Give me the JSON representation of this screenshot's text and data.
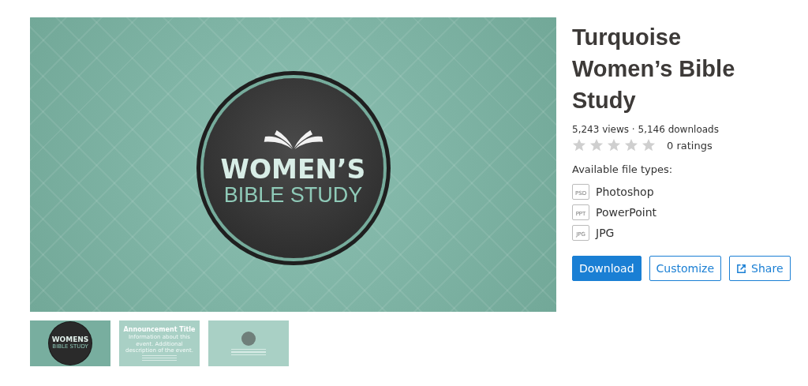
{
  "preview": {
    "line1": "WOMEN’S",
    "line2": "BIBLE STUDY"
  },
  "thumbnails": [
    {
      "kind": "badge",
      "line1": "WOMENS",
      "line2": "BIBLE STUDY"
    },
    {
      "kind": "announcement",
      "title": "Announcement Title",
      "text": "Information about this event. Additional description of the event."
    },
    {
      "kind": "badge-faded"
    }
  ],
  "title": "Turquoise Women’s Bible Study",
  "stats": "5,243 views · 5,146 downloads",
  "rating": {
    "stars": 0,
    "label": "0 ratings"
  },
  "file_types_heading": "Available file types:",
  "file_types": [
    {
      "tag": "PSD",
      "name": "Photoshop"
    },
    {
      "tag": "PPT",
      "name": "PowerPoint"
    },
    {
      "tag": "JPG",
      "name": "JPG"
    }
  ],
  "buttons": [
    {
      "kind": "primary",
      "label": "Download"
    },
    {
      "kind": "outline",
      "label": "Customize"
    },
    {
      "kind": "share",
      "label": "Share"
    }
  ]
}
